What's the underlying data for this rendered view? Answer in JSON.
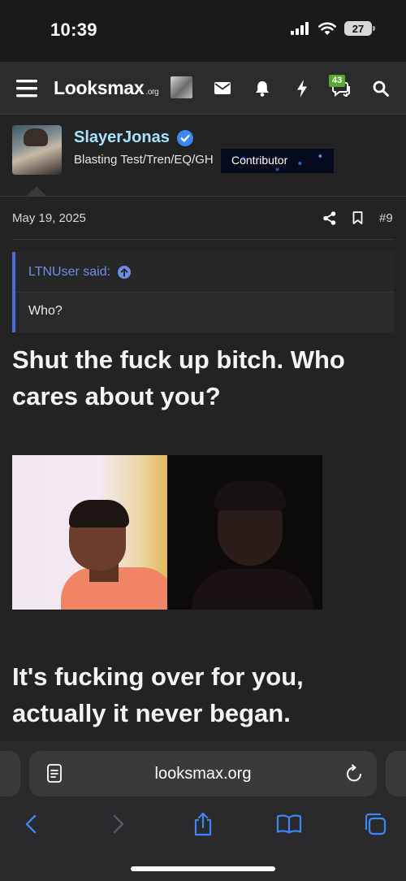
{
  "status_bar": {
    "time": "10:39",
    "battery": "27"
  },
  "nav": {
    "logo_main": "Looksmax",
    "logo_suffix": ".org",
    "alerts_badge": "43",
    "icons": [
      "menu-icon",
      "mail-icon",
      "bell-icon",
      "bolt-icon",
      "chat-icon",
      "search-icon"
    ]
  },
  "post": {
    "username": "SlayerJonas",
    "user_title": "Blasting Test/Tren/EQ/GH",
    "badge": "Contributor",
    "date": "May 19, 2025",
    "post_number": "#9",
    "quote": {
      "author": "LTNUser said:",
      "text": "Who?"
    },
    "text_1": "Shut the fuck up bitch. Who cares about you?",
    "text_2": "It's fucking over for you, actually it never began."
  },
  "browser": {
    "url": "looksmax.org"
  },
  "colors": {
    "accent": "#4d6bd6",
    "username": "#a7e3ff",
    "badge_green": "#5aa832",
    "ios_blue": "#3e86f5"
  }
}
